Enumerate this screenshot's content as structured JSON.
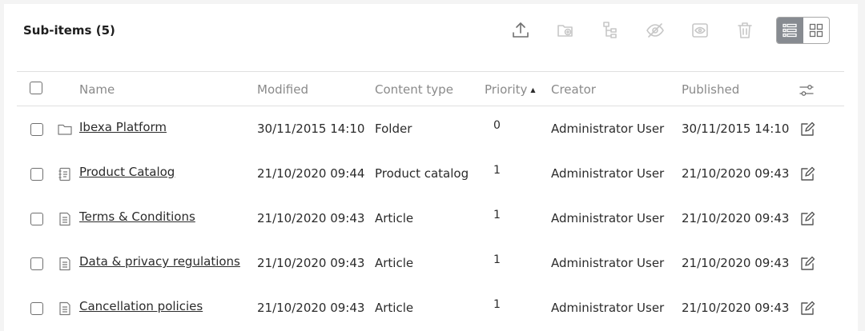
{
  "panel": {
    "title": "Sub-items (5)",
    "toolbar": [
      {
        "name": "upload-icon",
        "color": "#6f6f6f",
        "enabled": true
      },
      {
        "name": "move-to-folder-icon",
        "color": "#c7c7c7",
        "enabled": false
      },
      {
        "name": "copy-subtree-icon",
        "color": "#c7c7c7",
        "enabled": false
      },
      {
        "name": "hide-icon",
        "color": "#c7c7c7",
        "enabled": false
      },
      {
        "name": "reveal-icon",
        "color": "#c7c7c7",
        "enabled": false
      },
      {
        "name": "trash-icon",
        "color": "#c7c7c7",
        "enabled": false
      }
    ],
    "view_switch": {
      "active": "list",
      "options": [
        "list-view-icon",
        "grid-view-icon"
      ]
    }
  },
  "table": {
    "headers": {
      "name": "Name",
      "modified": "Modified",
      "content_type": "Content type",
      "priority": "Priority",
      "creator": "Creator",
      "published": "Published"
    },
    "sort": {
      "column": "priority",
      "direction": "ascending",
      "arrow": "▲"
    },
    "rows": [
      {
        "icon": "folder-icon",
        "name": "Ibexa Platform",
        "modified": "30/11/2015 14:10",
        "content_type": "Folder",
        "priority": "0",
        "creator": "Administrator User",
        "published": "30/11/2015 14:10"
      },
      {
        "icon": "product-catalog-icon",
        "name": "Product Catalog",
        "modified": "21/10/2020 09:44",
        "content_type": "Product catalog",
        "priority": "1",
        "creator": "Administrator User",
        "published": "21/10/2020 09:43"
      },
      {
        "icon": "article-icon",
        "name": "Terms & Conditions",
        "modified": "21/10/2020 09:43",
        "content_type": "Article",
        "priority": "1",
        "creator": "Administrator User",
        "published": "21/10/2020 09:43"
      },
      {
        "icon": "article-icon",
        "name": "Data & privacy regulations",
        "modified": "21/10/2020 09:43",
        "content_type": "Article",
        "priority": "1",
        "creator": "Administrator User",
        "published": "21/10/2020 09:43"
      },
      {
        "icon": "article-icon",
        "name": "Cancellation policies",
        "modified": "21/10/2020 09:43",
        "content_type": "Article",
        "priority": "1",
        "creator": "Administrator User",
        "published": "21/10/2020 09:43"
      }
    ]
  }
}
